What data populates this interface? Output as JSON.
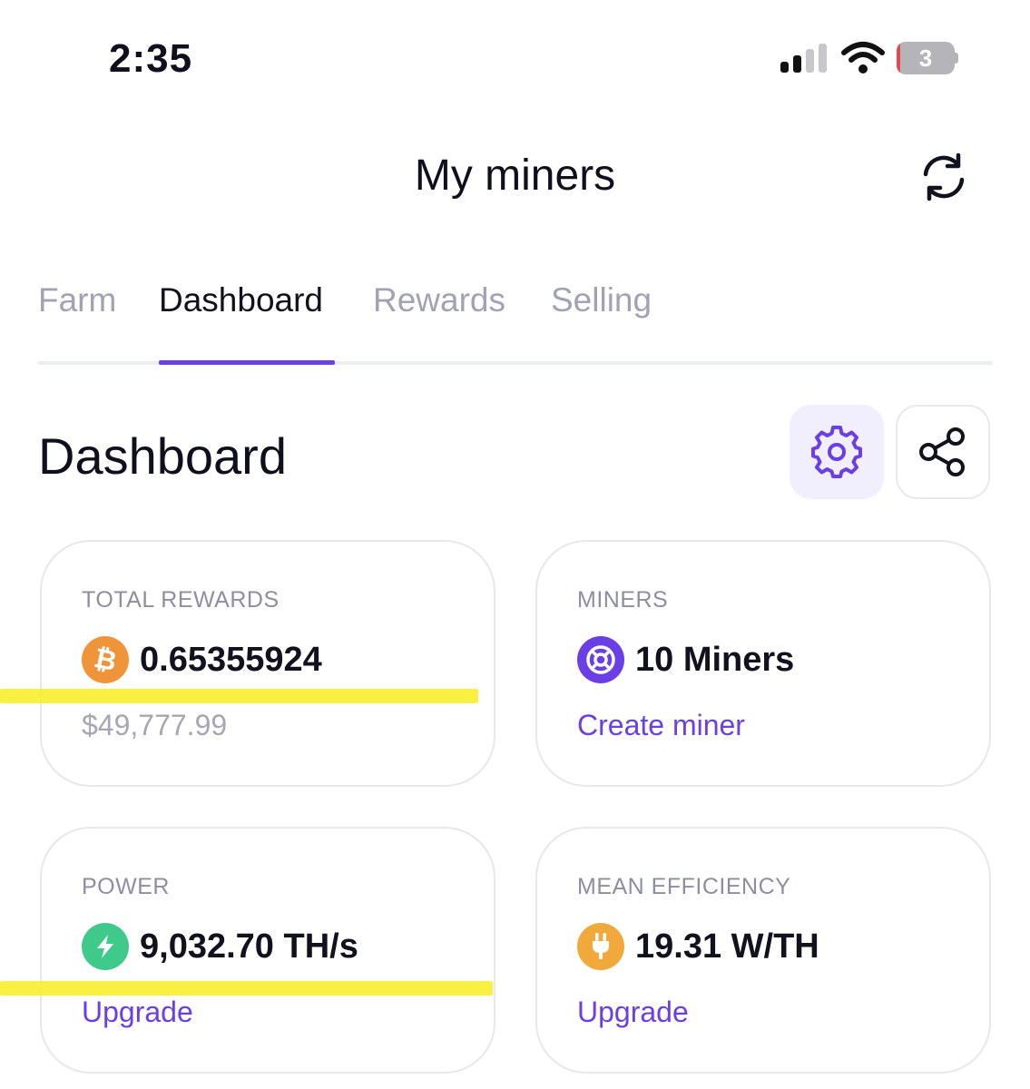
{
  "status_bar": {
    "time": "2:35",
    "battery_level": "3",
    "battery_percent": 3
  },
  "header": {
    "title": "My miners"
  },
  "tabs": [
    {
      "label": "Farm",
      "active": false
    },
    {
      "label": "Dashboard",
      "active": true
    },
    {
      "label": "Rewards",
      "active": false
    },
    {
      "label": "Selling",
      "active": false
    }
  ],
  "section": {
    "title": "Dashboard"
  },
  "cards": {
    "total_rewards": {
      "label": "TOTAL REWARDS",
      "value": "0.65355924",
      "sub": "$49,777.99",
      "icon": "bitcoin-icon"
    },
    "miners": {
      "label": "MINERS",
      "value": "10 Miners",
      "link": "Create miner",
      "icon": "miner-icon"
    },
    "power": {
      "label": "POWER",
      "value": "9,032.70 TH/s",
      "link": "Upgrade",
      "icon": "lightning-icon"
    },
    "mean_efficiency": {
      "label": "MEAN EFFICIENCY",
      "value": "19.31 W/TH",
      "link": "Upgrade",
      "icon": "plug-icon"
    }
  },
  "colors": {
    "accent": "#6a3fe6",
    "bitcoin": "#f0943a",
    "miner": "#6a3fe6",
    "power": "#3fc98a",
    "efficiency": "#f2a93b",
    "highlight": "#f8ee2c"
  }
}
